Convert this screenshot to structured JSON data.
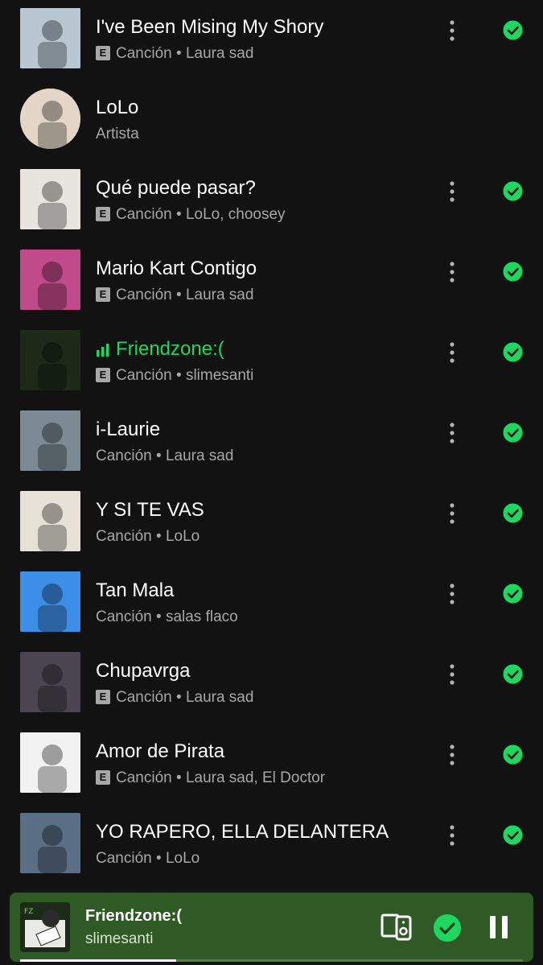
{
  "tracks": [
    {
      "title": "I've Been Mising My Shory",
      "explicit": true,
      "type": "Canción",
      "artist": "Laura sad",
      "thumb_color": "#b9c7d3",
      "thumb_icon": "album-cover-photo"
    },
    {
      "title": "LoLo",
      "explicit": false,
      "type": "Artista",
      "artist": "",
      "thumb_color": "#e3d6c8",
      "thumb_icon": "artist-photo"
    },
    {
      "title": "Qué puede pasar?",
      "explicit": true,
      "type": "Canción",
      "artist": "LoLo, choosey",
      "thumb_color": "#e8e4e0",
      "thumb_icon": "album-cover-collage"
    },
    {
      "title": "Mario Kart Contigo",
      "explicit": true,
      "type": "Canción",
      "artist": "Laura sad",
      "thumb_color": "#c04a8a",
      "thumb_icon": "album-cover-art"
    },
    {
      "title": "Friendzone:(",
      "explicit": true,
      "type": "Canción",
      "artist": "slimesanti",
      "thumb_color": "#1d2a1a",
      "thumb_icon": "album-cover-drawing",
      "playing": true
    },
    {
      "title": "i-Laurie",
      "explicit": false,
      "type": "Canción",
      "artist": "Laura sad",
      "thumb_color": "#7c8a94",
      "thumb_icon": "album-cover-collage"
    },
    {
      "title": "Y SI TE VAS",
      "explicit": false,
      "type": "Canción",
      "artist": "LoLo",
      "thumb_color": "#e6e2d8",
      "thumb_icon": "album-cover-drawing"
    },
    {
      "title": "Tan Mala",
      "explicit": false,
      "type": "Canción",
      "artist": "salas flaco",
      "thumb_color": "#3d8ee6",
      "thumb_icon": "album-cover-hands"
    },
    {
      "title": "Chupavrga",
      "explicit": true,
      "type": "Canción",
      "artist": "Laura sad",
      "thumb_color": "#4a4550",
      "thumb_icon": "album-cover-photo"
    },
    {
      "title": "Amor de Pirata",
      "explicit": true,
      "type": "Canción",
      "artist": "Laura sad, El Doctor",
      "thumb_color": "#f2f2f2",
      "thumb_icon": "album-cover-sketch"
    },
    {
      "title": "YO RAPERO, ELLA DELANTERA",
      "explicit": false,
      "type": "Canción",
      "artist": "LoLo",
      "thumb_color": "#5a6e86",
      "thumb_icon": "album-cover-photo"
    }
  ],
  "labels": {
    "explicit_badge": "E",
    "separator": " • "
  },
  "now_playing": {
    "title": "Friendzone:(",
    "artist": "slimesanti",
    "progress": 0.31
  },
  "colors": {
    "accent": "#1ed760",
    "background": "#121212",
    "miniplayer": "#2f5a25",
    "subtext": "#a7a7a7"
  }
}
